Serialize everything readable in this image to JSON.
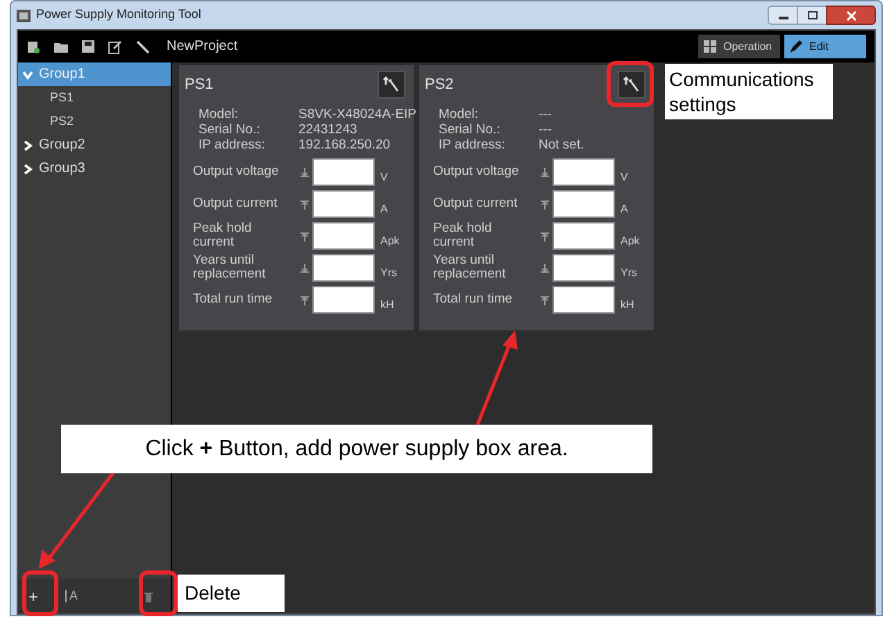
{
  "window": {
    "title": "Power Supply Monitoring Tool"
  },
  "toolbar": {
    "project_name": "NewProject",
    "modes": [
      {
        "label": "Operation",
        "selected": false
      },
      {
        "label": "Edit",
        "selected": true
      }
    ]
  },
  "sidebar": {
    "groups": [
      {
        "label": "Group1",
        "expanded": true,
        "selected": true,
        "children": [
          {
            "label": "PS1"
          },
          {
            "label": "PS2"
          }
        ]
      },
      {
        "label": "Group2",
        "expanded": false,
        "selected": false
      },
      {
        "label": "Group3",
        "expanded": false,
        "selected": false
      }
    ],
    "name_field": {
      "value": "A"
    }
  },
  "cards": [
    {
      "title": "PS1",
      "info": [
        {
          "label": "Model:",
          "value": "S8VK-X48024A-EIP"
        },
        {
          "label": "Serial No.:",
          "value": "22431243"
        },
        {
          "label": "IP address:",
          "value": "192.168.250.20"
        }
      ],
      "readings": [
        {
          "label": "Output voltage",
          "kind": "lower",
          "unit": "V"
        },
        {
          "label": "Output current",
          "kind": "upper",
          "unit": "A"
        },
        {
          "label": "Peak hold current",
          "kind": "upper",
          "unit": "Apk"
        },
        {
          "label": "Years until replacement",
          "kind": "lower",
          "unit": "Yrs"
        },
        {
          "label": "Total run time",
          "kind": "upper",
          "unit": "kH"
        }
      ]
    },
    {
      "title": "PS2",
      "info": [
        {
          "label": "Model:",
          "value": "---"
        },
        {
          "label": "Serial No.:",
          "value": "---"
        },
        {
          "label": "IP address:",
          "value": "Not set."
        }
      ],
      "readings": [
        {
          "label": "Output voltage",
          "kind": "lower",
          "unit": "V"
        },
        {
          "label": "Output current",
          "kind": "upper",
          "unit": "A"
        },
        {
          "label": "Peak hold current",
          "kind": "upper",
          "unit": "Apk"
        },
        {
          "label": "Years until replacement",
          "kind": "lower",
          "unit": "Yrs"
        },
        {
          "label": "Total run time",
          "kind": "upper",
          "unit": "kH"
        }
      ]
    }
  ],
  "annotations": {
    "communications": "Communications settings",
    "add": "Click **+** Button, add power supply box area.",
    "delete": "Delete",
    "add_button": "+"
  }
}
